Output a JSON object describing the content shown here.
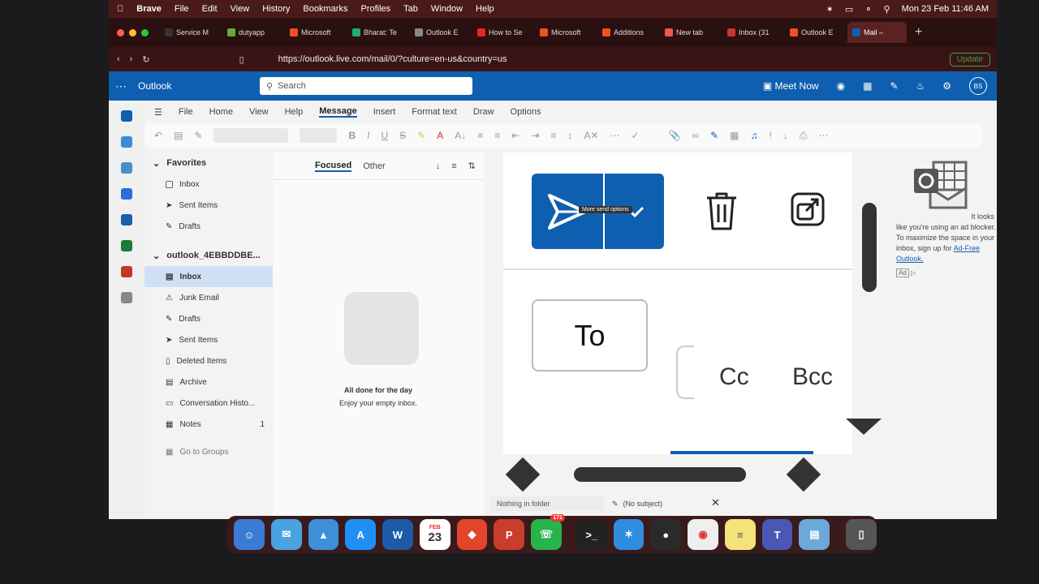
{
  "mac_menu": {
    "app": "Brave",
    "items": [
      "File",
      "Edit",
      "View",
      "History",
      "Bookmarks",
      "Profiles",
      "Tab",
      "Window",
      "Help"
    ],
    "clock": "Mon 23 Feb  11:46 AM"
  },
  "browser_tabs": [
    {
      "label": "Service M",
      "color": "#333"
    },
    {
      "label": "dutyapp",
      "color": "#6a3"
    },
    {
      "label": "Microsoft",
      "color": "#f25022"
    },
    {
      "label": "Bharat: Te",
      "color": "#2a7"
    },
    {
      "label": "Outlook E",
      "color": "#888"
    },
    {
      "label": "How to Se",
      "color": "#e22"
    },
    {
      "label": "Microsoft",
      "color": "#f25022"
    },
    {
      "label": "Additions",
      "color": "#f25022"
    },
    {
      "label": "New tab",
      "color": "#e55"
    },
    {
      "label": "Inbox (31",
      "color": "#c33"
    },
    {
      "label": "Outlook E",
      "color": "#f25022"
    },
    {
      "label": "Mail –",
      "color": "#0f5fb0",
      "active": true
    }
  ],
  "address_bar": {
    "url": "https://outlook.live.com/mail/0/?culture=en-us&country=us",
    "update_label": "Update"
  },
  "outlook_header": {
    "app_name": "Outlook",
    "search_placeholder": "Search",
    "meet_now": "Meet Now",
    "avatar_initials": "BS"
  },
  "ribbon_tabs": [
    "File",
    "Home",
    "View",
    "Help",
    "Message",
    "Insert",
    "Format text",
    "Draw",
    "Options"
  ],
  "ribbon_selected": "Message",
  "folders": {
    "favorites_label": "Favorites",
    "favorites": [
      "Inbox",
      "Sent Items",
      "Drafts"
    ],
    "account_label": "outlook_4EBBDDBE...",
    "account_items": [
      {
        "label": "Inbox",
        "selected": true,
        "count": ""
      },
      {
        "label": "Junk Email",
        "count": ""
      },
      {
        "label": "Drafts",
        "count": ""
      },
      {
        "label": "Sent Items",
        "count": ""
      },
      {
        "label": "Deleted Items",
        "count": ""
      },
      {
        "label": "Archive",
        "count": ""
      },
      {
        "label": "Conversation Histo...",
        "count": ""
      },
      {
        "label": "Notes",
        "count": "1"
      }
    ],
    "groups_link": "Go to Groups"
  },
  "message_list": {
    "focused": "Focused",
    "other": "Other",
    "empty_title": "All done for the day",
    "empty_subtitle": "Enjoy your empty inbox."
  },
  "compose": {
    "send_tooltip": "More send options",
    "to_label": "To",
    "cc_label": "Cc",
    "bcc_label": "Bcc"
  },
  "status_bar": {
    "folder_status": "Nothing in folder",
    "subject": "(No subject)"
  },
  "ad": {
    "text": "It looks like you're using an ad blocker. To maximize the space in your inbox, sign up for",
    "link": "Ad-Free Outlook.",
    "badge": "Ad"
  },
  "dock": {
    "calendar_month": "FEB",
    "calendar_day": "23",
    "whatsapp_badge": "171"
  },
  "colors": {
    "outlook_blue": "#0f5fb0",
    "selected_folder": "#cfe0f4",
    "brave_bar": "#3a1414"
  }
}
